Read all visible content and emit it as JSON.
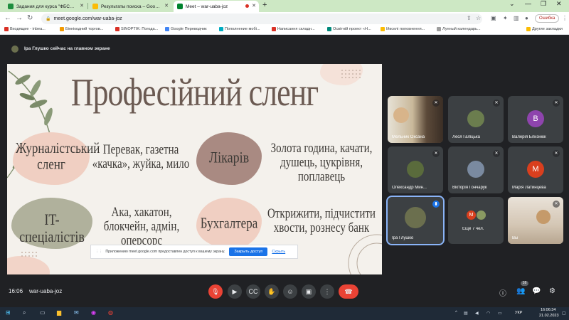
{
  "browser": {
    "tabs": [
      {
        "title": "Задания для курса \"ФБС-13 УКР\"",
        "favicon_color": "#1e8e3e",
        "active": false
      },
      {
        "title": "Результаты поиска – Google Диск",
        "favicon_color": "#fbbc04",
        "active": false
      },
      {
        "title": "Meet – war-uaba-joz",
        "favicon_color": "#00832d",
        "active": true
      }
    ],
    "new_tab": "+",
    "url": "meet.google.com/war-uaba-joz",
    "profile_label": "Ошибка",
    "bookmarks": [
      {
        "label": "Входящие - inbea...",
        "icon_color": "#d93025"
      },
      {
        "label": "Біннікодний торгов...",
        "icon_color": "#f29900"
      },
      {
        "label": "SINOPTIK: Погода...",
        "icon_color": "#d93025"
      },
      {
        "label": "Google Переводчик",
        "icon_color": "#4285f4"
      },
      {
        "label": "Пополнение мобі...",
        "icon_color": "#00acc1"
      },
      {
        "label": "Написання складн...",
        "icon_color": "#d93025"
      },
      {
        "label": "Освітній проект «Н...",
        "icon_color": "#00897b"
      },
      {
        "label": "Ійкселі поповнення...",
        "icon_color": "#fbbc04"
      },
      {
        "label": "Лунный календарь...",
        "icon_color": "#9e9e9e"
      },
      {
        "label": "Другие закладки",
        "icon_color": "#fbbc04"
      }
    ]
  },
  "meet": {
    "presenter_text": "Іра Глушко сейчас на главном экране",
    "slide": {
      "title": "Професійний сленг",
      "rows": [
        {
          "left_label": "Журналістський сленг",
          "left_text": "Перевак, газетна «качка», жуйка, мило",
          "right_label": "Лікарів",
          "right_text": "Золота година, качати, душець, цукрiвня, поплавець"
        },
        {
          "left_label": "IT-спеціалістів",
          "left_text": "Ака, хакатон, блокчейн, адмін, оперсорс",
          "right_label": "Бухгалтера",
          "right_text": "Открижити, підчистити хвости, рознесу банк"
        }
      ]
    },
    "share_notice": {
      "text": "Приложению meet.google.com предоставлен доступ к вашему экрану.",
      "stop_label": "Закрыть доступ",
      "hide_label": "Скрыть"
    },
    "participants": [
      {
        "name": "Мельник Оксана",
        "avatar": "",
        "color": "#7a6a55",
        "muted": true
      },
      {
        "name": "Леся Галіцька",
        "avatar": "",
        "color": "#6b7d4e",
        "muted": true
      },
      {
        "name": "Валерія Близнюк",
        "avatar": "В",
        "color": "#8e44ad",
        "muted": true
      },
      {
        "name": "Олександр Мин...",
        "avatar": "",
        "color": "#5a6b3c",
        "muted": true
      },
      {
        "name": "Вікторія Гончарук",
        "avatar": "",
        "color": "#7a8aa0",
        "muted": true
      },
      {
        "name": "Марія Латинцева",
        "avatar": "М",
        "color": "#d93f1e",
        "muted": true
      },
      {
        "name": "Іра Глушко",
        "avatar": "",
        "color": "#6b6f4e",
        "muted": false,
        "speaking": true
      },
      {
        "name": "Ещё 7 чел.",
        "avatar": "М",
        "color": "#d93f1e",
        "muted": false
      },
      {
        "name": "Вы",
        "avatar": "",
        "color": "#c9b8a5",
        "muted": true
      }
    ],
    "time": "16:06",
    "meeting_code": "war-uaba-joz",
    "people_count": "16"
  },
  "taskbar": {
    "lang": "УКР",
    "time": "16:06:34",
    "date": "21.02.2023"
  },
  "colors": {
    "hangup": "#ea4335",
    "slide_bg": "#f4f1ec",
    "accent_blue": "#1a73e8"
  }
}
